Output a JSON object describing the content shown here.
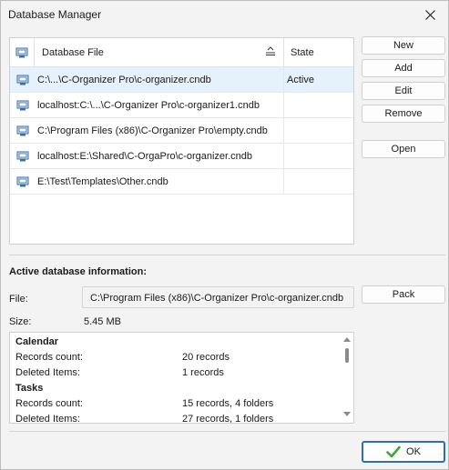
{
  "window": {
    "title": "Database Manager"
  },
  "table": {
    "columns": {
      "file": "Database File",
      "state": "State"
    },
    "rows": [
      {
        "file": "C:\\...\\C-Organizer Pro\\c-organizer.cndb",
        "state": "Active"
      },
      {
        "file": "localhost:C:\\...\\C-Organizer Pro\\c-organizer1.cndb",
        "state": ""
      },
      {
        "file": "C:\\Program Files (x86)\\C-Organizer Pro\\empty.cndb",
        "state": ""
      },
      {
        "file": "localhost:E:\\Shared\\C-OrgaPro\\c-organizer.cndb",
        "state": ""
      },
      {
        "file": "E:\\Test\\Templates\\Other.cndb",
        "state": ""
      }
    ]
  },
  "buttons": {
    "new": "New",
    "add": "Add",
    "edit": "Edit",
    "remove": "Remove",
    "open": "Open",
    "pack": "Pack",
    "ok": "OK"
  },
  "info": {
    "title": "Active database information:",
    "file_label": "File:",
    "file_value": "C:\\Program Files (x86)\\C-Organizer Pro\\c-organizer.cndb",
    "size_label": "Size:",
    "size_value": "5.45 MB",
    "sections": [
      {
        "name": "Calendar",
        "rows": [
          {
            "label": "Records count:",
            "value": "20 records"
          },
          {
            "label": "Deleted Items:",
            "value": "1 records"
          }
        ]
      },
      {
        "name": "Tasks",
        "rows": [
          {
            "label": "Records count:",
            "value": "15 records, 4 folders"
          },
          {
            "label": "Deleted Items:",
            "value": "27 records, 1 folders"
          }
        ]
      }
    ]
  },
  "colors": {
    "selected_row": "#e5f1fb",
    "ok_border": "#2a6fb8",
    "ok_check": "#3aa935"
  }
}
